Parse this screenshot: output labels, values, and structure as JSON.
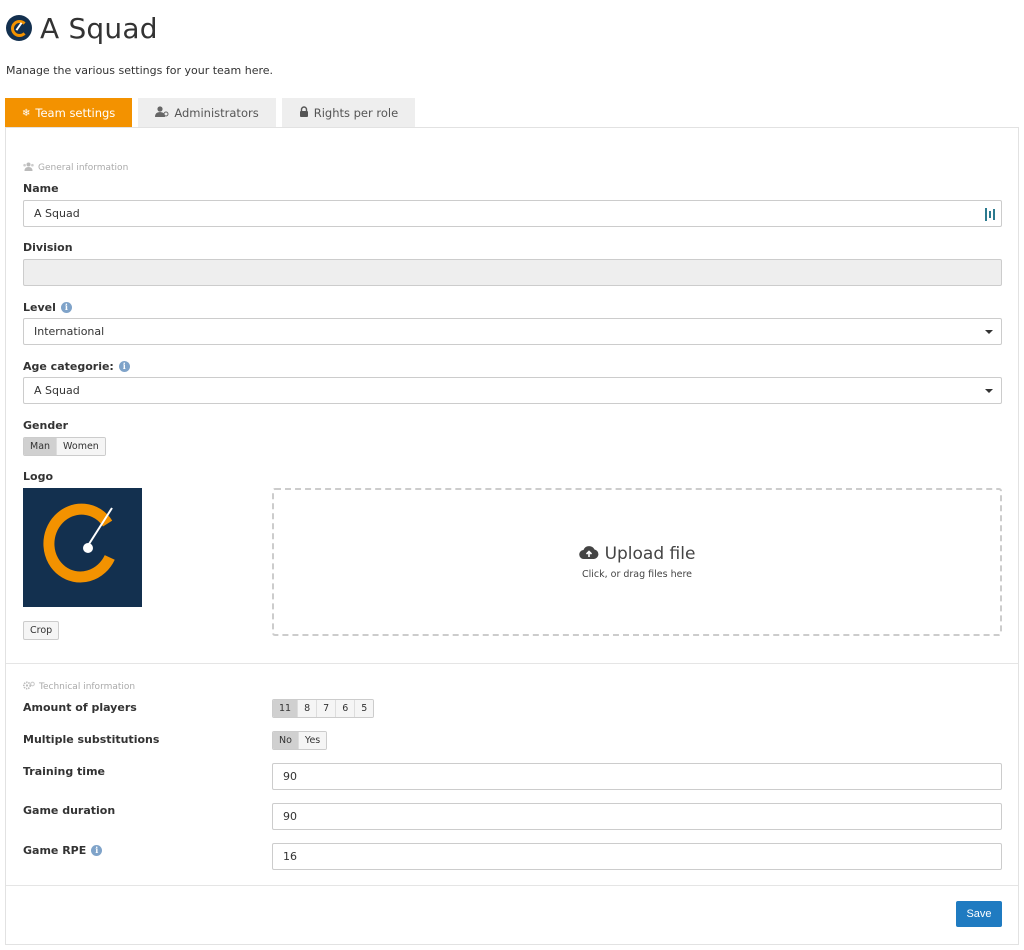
{
  "header": {
    "title": "A Squad",
    "subtitle": "Manage the various settings for your team here."
  },
  "tabs": [
    {
      "label": "Team settings",
      "icon": "gear-icon",
      "active": true
    },
    {
      "label": "Administrators",
      "icon": "admin-user-icon",
      "active": false
    },
    {
      "label": "Rights per role",
      "icon": "lock-icon",
      "active": false
    }
  ],
  "general": {
    "section_title": "General information",
    "name_label": "Name",
    "name_value": "A Squad",
    "division_label": "Division",
    "division_value": "",
    "level_label": "Level",
    "level_value": "International",
    "age_label": "Age categorie:",
    "age_value": "A Squad",
    "gender_label": "Gender",
    "gender_options": [
      "Man",
      "Women"
    ],
    "gender_selected": "Man",
    "logo_label": "Logo",
    "crop_label": "Crop",
    "upload_title": "Upload file",
    "upload_sub": "Click, or drag files here"
  },
  "technical": {
    "section_title": "Technical information",
    "players_label": "Amount of players",
    "players_options": [
      "11",
      "8",
      "7",
      "6",
      "5"
    ],
    "players_selected": "11",
    "subs_label": "Multiple substitutions",
    "subs_options": [
      "No",
      "Yes"
    ],
    "subs_selected": "No",
    "training_label": "Training time",
    "training_value": "90",
    "duration_label": "Game duration",
    "duration_value": "90",
    "rpe_label": "Game RPE",
    "rpe_value": "16"
  },
  "footer": {
    "save_label": "Save"
  },
  "colors": {
    "accent": "#f39200",
    "primary_button": "#1f7bc1",
    "logo_bg": "#13304f"
  }
}
